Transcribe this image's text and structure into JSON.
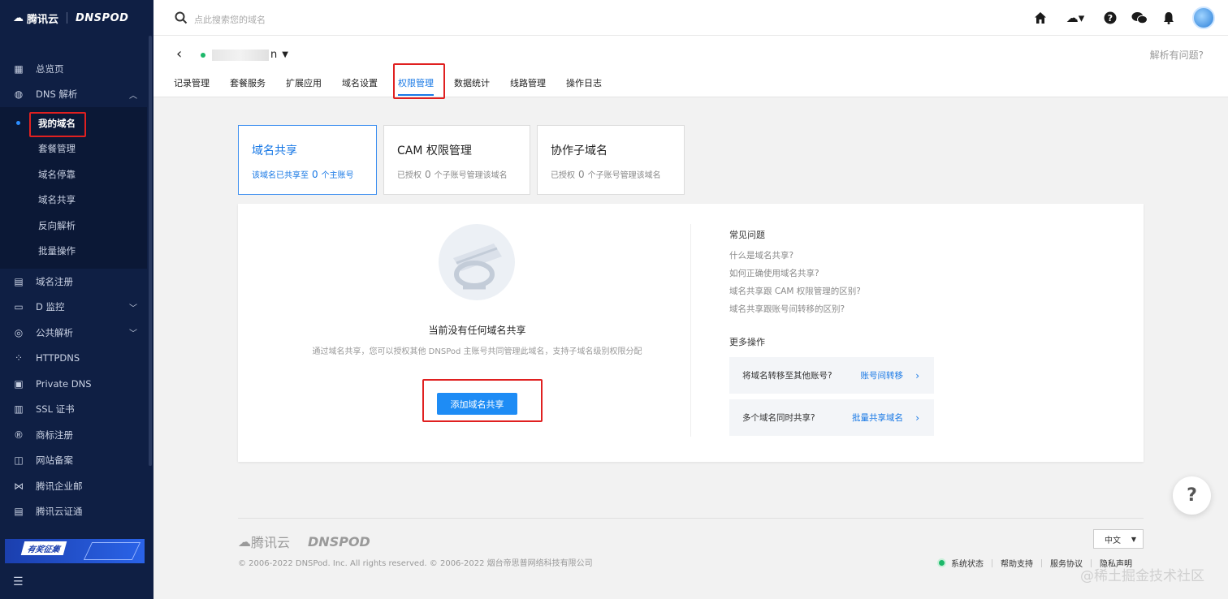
{
  "sidebar": {
    "brand": "腾讯云",
    "brand2": "DNSPOD",
    "items": [
      {
        "label": "总览页",
        "icon": "grid-icon"
      },
      {
        "label": "DNS 解析",
        "icon": "globe-icon",
        "expanded": true
      }
    ],
    "subitems": [
      {
        "label": "我的域名",
        "active": true
      },
      {
        "label": "套餐管理"
      },
      {
        "label": "域名停靠"
      },
      {
        "label": "域名共享"
      },
      {
        "label": "反向解析"
      },
      {
        "label": "批量操作"
      }
    ],
    "items2": [
      {
        "label": "域名注册",
        "icon": "calendar-icon"
      },
      {
        "label": "D 监控",
        "icon": "monitor-icon",
        "chevron": true
      },
      {
        "label": "公共解析",
        "icon": "globe2-icon",
        "chevron": true
      },
      {
        "label": "HTTPDNS",
        "icon": "nodes-icon"
      },
      {
        "label": "Private DNS",
        "icon": "lock-icon"
      },
      {
        "label": "SSL 证书",
        "icon": "certificate-icon"
      },
      {
        "label": "商标注册",
        "icon": "registered-icon"
      },
      {
        "label": "网站备案",
        "icon": "filing-icon"
      },
      {
        "label": "腾讯企业邮",
        "icon": "mail-icon"
      },
      {
        "label": "腾讯云证通",
        "icon": "idcard-icon"
      }
    ],
    "banner": "有奖征集"
  },
  "topbar": {
    "search_placeholder": "点此搜索您的域名"
  },
  "domain_header": {
    "domain_suffix": "n",
    "help_link": "解析有问题?",
    "tabs": [
      "记录管理",
      "套餐服务",
      "扩展应用",
      "域名设置",
      "权限管理",
      "数据统计",
      "线路管理",
      "操作日志"
    ],
    "active_tab": 4
  },
  "cards": [
    {
      "title": "域名共享",
      "sub_prefix": "该域名已共享至",
      "count": "0",
      "sub_suffix": "个主账号"
    },
    {
      "title": "CAM 权限管理",
      "sub_prefix": "已授权",
      "count": "0",
      "sub_suffix": "个子账号管理该域名"
    },
    {
      "title": "协作子域名",
      "sub_prefix": "已授权",
      "count": "0",
      "sub_suffix": "个子账号管理该域名"
    }
  ],
  "empty": {
    "title": "当前没有任何域名共享",
    "desc": "通过域名共享，您可以授权其他 DNSPod 主账号共同管理此域名，支持子域名级别权限分配",
    "button": "添加域名共享"
  },
  "faq": {
    "title": "常见问题",
    "items": [
      "什么是域名共享?",
      "如何正确使用域名共享?",
      "域名共享跟 CAM 权限管理的区别?",
      "域名共享跟账号间转移的区别?"
    ]
  },
  "more": {
    "title": "更多操作",
    "items": [
      {
        "label": "将域名转移至其他账号?",
        "link": "账号间转移"
      },
      {
        "label": "多个域名同时共享?",
        "link": "批量共享域名"
      }
    ]
  },
  "footer": {
    "brand": "腾讯云",
    "brand2": "DNSPOD",
    "copyright": "© 2006-2022 DNSPod. Inc. All rights reserved. © 2006-2022 烟台帝思普网络科技有限公司",
    "lang": "中文",
    "links": [
      "系统状态",
      "帮助支持",
      "服务协议",
      "隐私声明"
    ]
  },
  "watermark": "@稀土掘金技术社区"
}
